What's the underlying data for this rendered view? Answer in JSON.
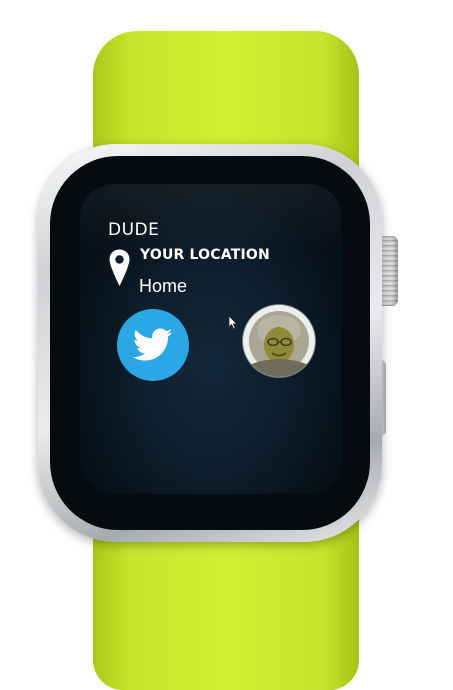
{
  "app": {
    "title": "DUDE"
  },
  "location": {
    "label": "YOUR LOCATION",
    "value": "Home"
  },
  "icons": {
    "pin": "map-pin-icon",
    "twitter": "twitter-bird-icon",
    "cursor": "mouse-pointer-icon",
    "avatar": "user-avatar"
  },
  "colors": {
    "band": "#d2ee34",
    "screen": "#0d1d2b",
    "twitter": "#2ca7e6",
    "text": "#ffffff"
  }
}
